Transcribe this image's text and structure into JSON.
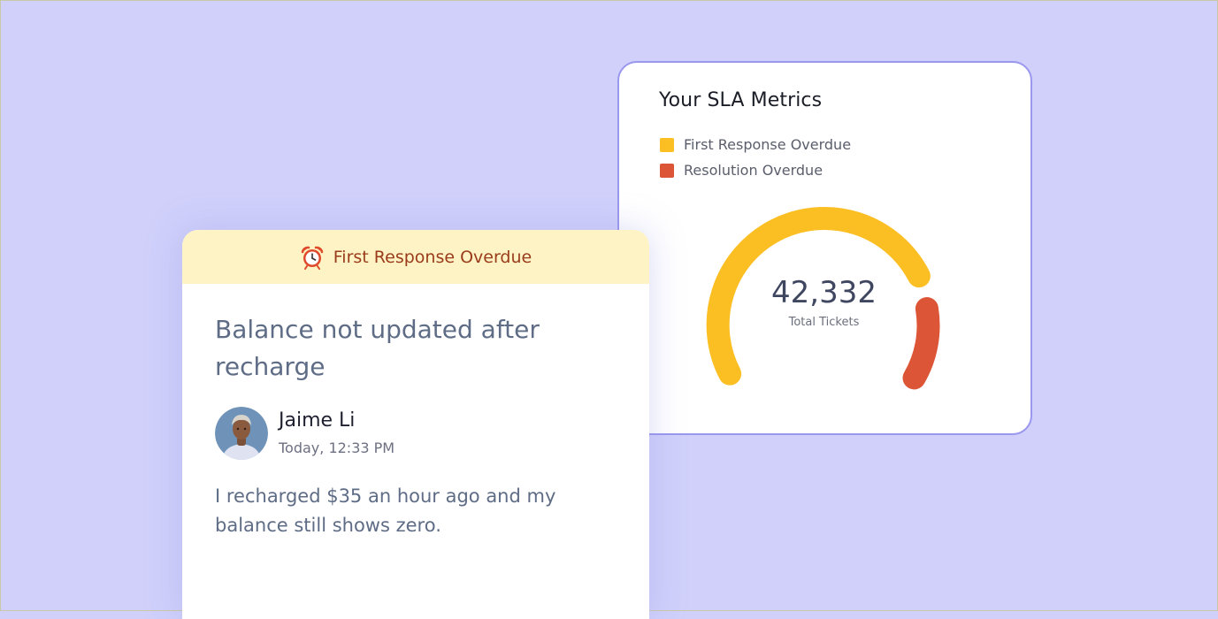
{
  "sla": {
    "title": "Your SLA Metrics",
    "legend": [
      {
        "label": "First Response Overdue",
        "color": "#fbbf24"
      },
      {
        "label": "Resolution Overdue",
        "color": "#dc5536"
      }
    ],
    "total_value": "42,332",
    "total_label": "Total Tickets"
  },
  "ticket": {
    "status_icon": "alarm-clock-icon",
    "status": "First Response Overdue",
    "subject": "Balance not updated after recharge",
    "requester_name": "Jaime Li",
    "requester_time": "Today, 12:33 PM",
    "message": "I recharged $35 an hour ago and my balance still shows zero."
  }
}
